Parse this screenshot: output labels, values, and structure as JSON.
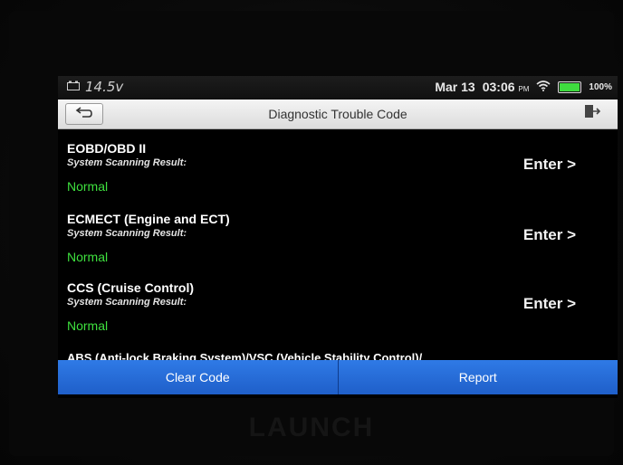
{
  "status_bar": {
    "voltage": "14.5v",
    "date": "Mar 13",
    "time": "03:06",
    "ampm": "PM",
    "battery_level": 1.0,
    "battery_text": "100%"
  },
  "header": {
    "title": "Diagnostic Trouble Code"
  },
  "systems": [
    {
      "name": "EOBD/OBD II",
      "result_label": "System Scanning Result:",
      "status": "Normal",
      "action": "Enter >"
    },
    {
      "name": "ECMECT (Engine and ECT)",
      "result_label": "System Scanning Result:",
      "status": "Normal",
      "action": "Enter >"
    },
    {
      "name": "CCS (Cruise Control)",
      "result_label": "System Scanning Result:",
      "status": "Normal",
      "action": "Enter >"
    }
  ],
  "partial_row": "ABS (Anti-lock Braking System)/VSC (Vehicle Stability Control)/",
  "actions": {
    "clear_code": "Clear Code",
    "report": "Report"
  },
  "device": {
    "brand": "LAUNCH"
  },
  "colors": {
    "status_normal": "#3ee03e",
    "action_bar": "#2a6fdd"
  }
}
